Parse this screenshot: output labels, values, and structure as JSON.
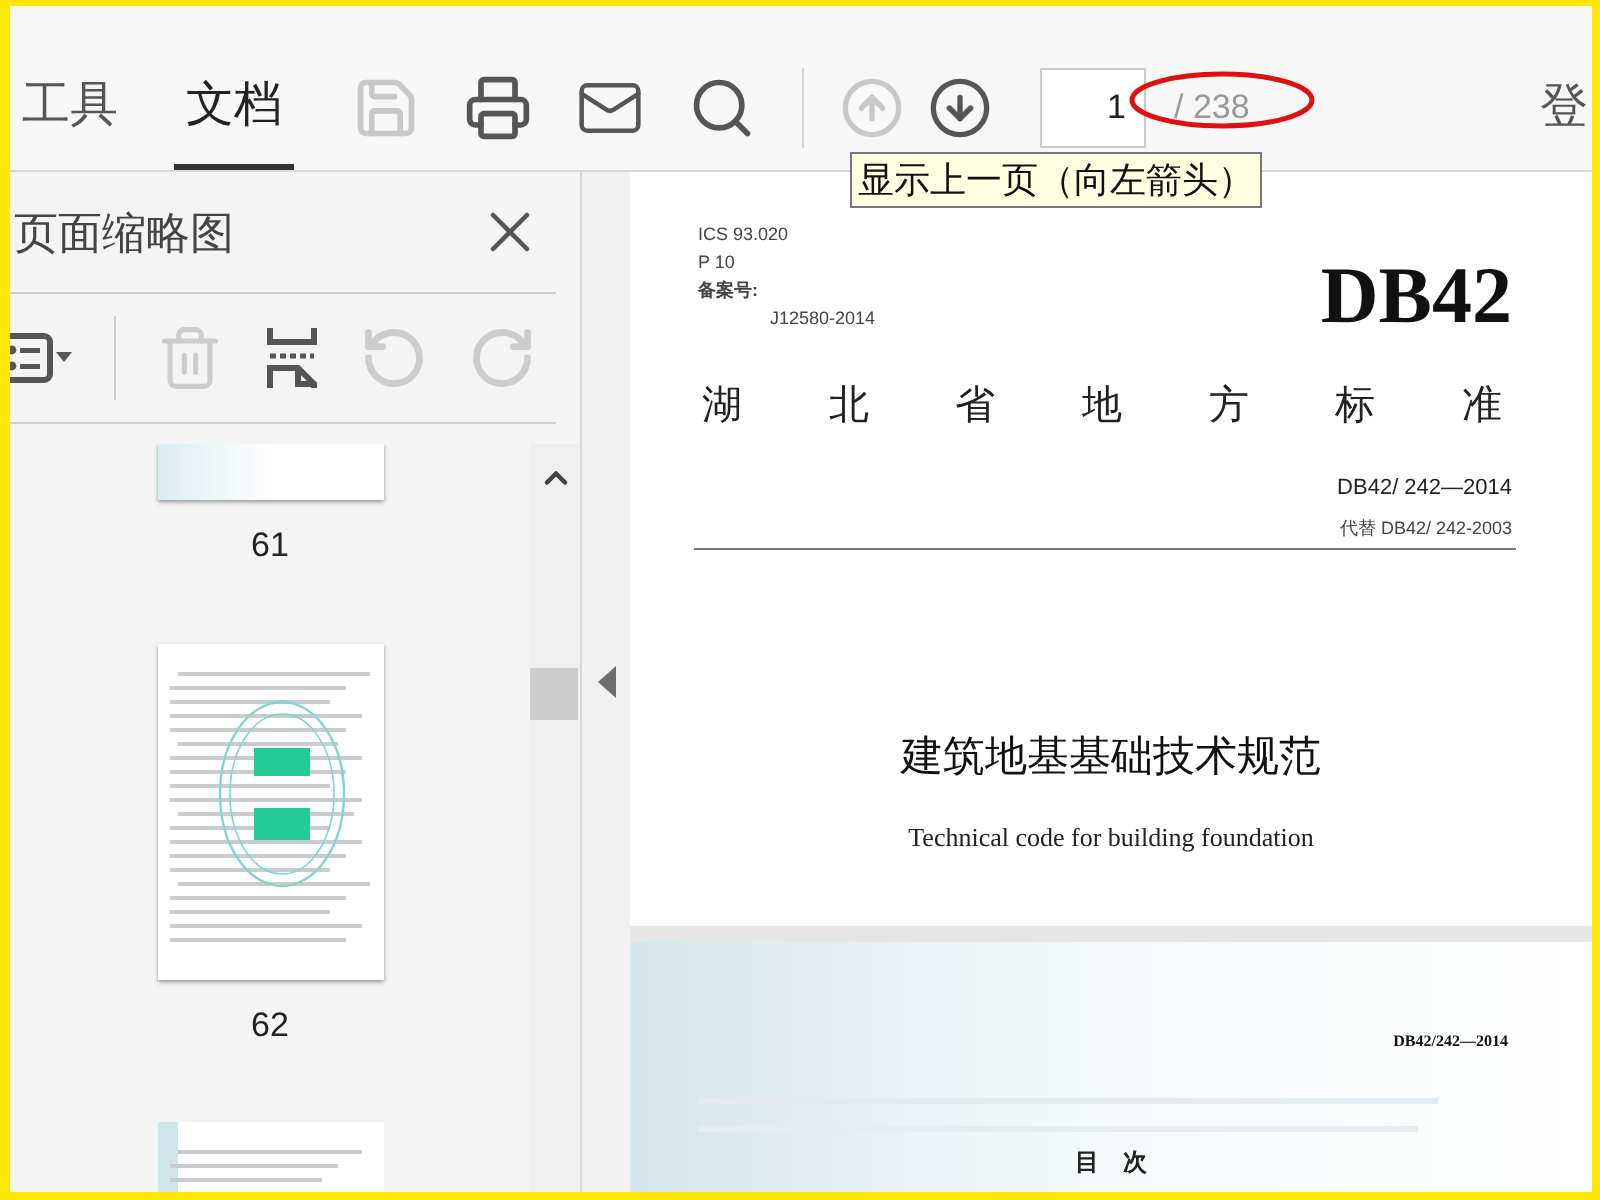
{
  "toolbar": {
    "tabs": [
      {
        "label": "工具",
        "selected": false
      },
      {
        "label": "文档",
        "selected": true
      }
    ],
    "tools": [
      {
        "kind": "save",
        "disabled": true
      },
      {
        "kind": "print",
        "disabled": false
      },
      {
        "kind": "mail",
        "disabled": false
      },
      {
        "kind": "search",
        "disabled": false
      }
    ],
    "nav": [
      {
        "kind": "prev",
        "disabled": true
      },
      {
        "kind": "next",
        "disabled": false
      }
    ],
    "page_input": "1",
    "page_total": "/ 238",
    "right_text": "登"
  },
  "tooltip": "显示上一页（向左箭头）",
  "thumbnail_panel": {
    "title": "页面缩略图",
    "tools": [
      {
        "kind": "options",
        "disabled": false
      },
      {
        "kind": "delete",
        "disabled": true
      },
      {
        "kind": "extract",
        "disabled": false
      },
      {
        "kind": "rotate_left",
        "disabled": true
      },
      {
        "kind": "rotate_right",
        "disabled": true
      }
    ],
    "thumbnails": [
      {
        "kind": "cut_top",
        "label": "61"
      },
      {
        "kind": "stamped",
        "label": "62"
      },
      {
        "kind": "cut_bottom"
      }
    ]
  },
  "document": {
    "cover": {
      "ics": "ICS 93.020",
      "p": "P 10",
      "record_label": "备案号:",
      "record_no": "J12580-2014",
      "code": "DB42",
      "org": "湖北省地方标准",
      "number": "DB42/ 242—2014",
      "replaces": "代替 DB42/ 242-2003",
      "title": "建筑地基基础技术规范",
      "subtitle": "Technical code for building foundation"
    },
    "next_page": {
      "number": "DB42/242—2014",
      "heading": "目　次"
    }
  }
}
